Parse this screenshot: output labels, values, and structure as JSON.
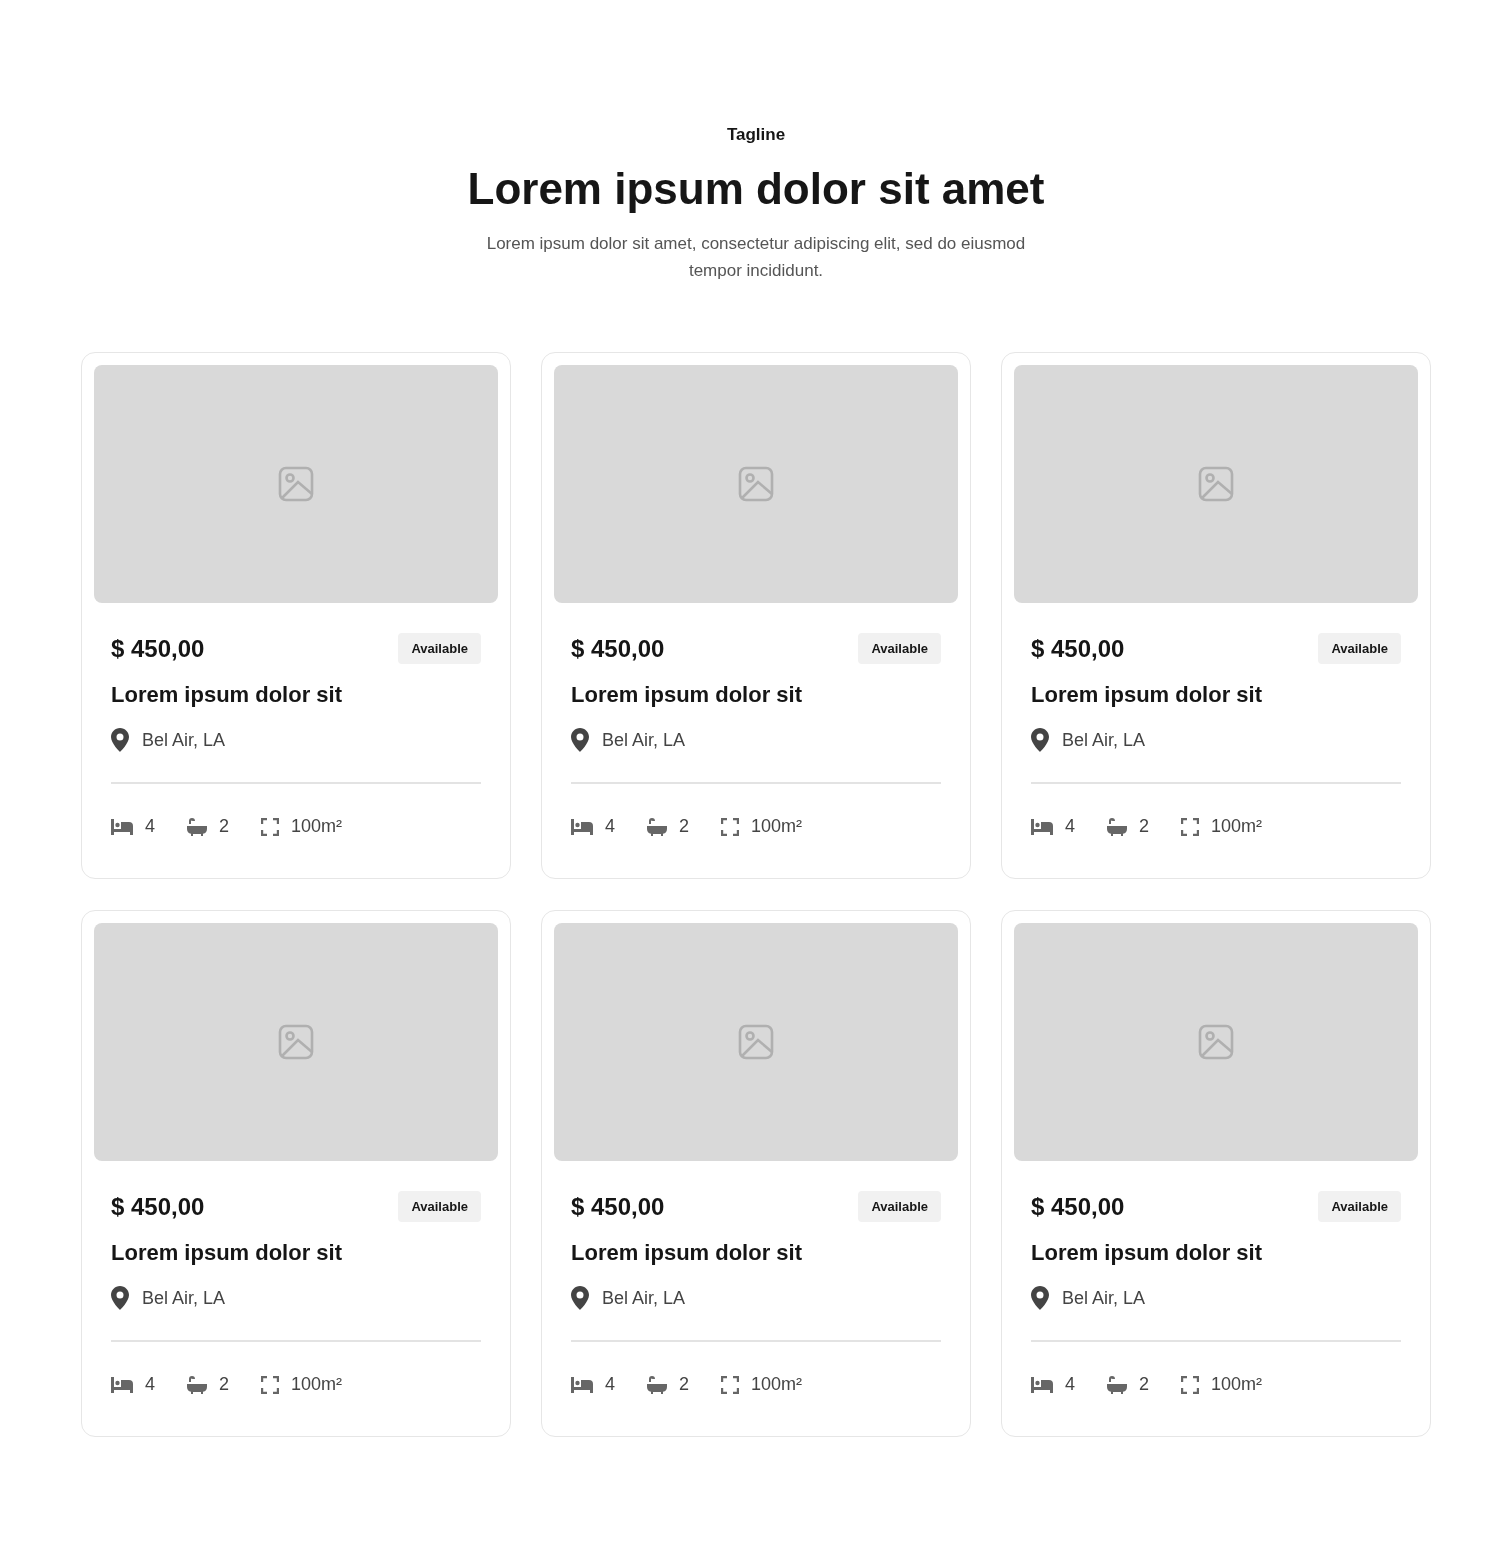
{
  "header": {
    "tagline": "Tagline",
    "title": "Lorem ipsum dolor sit amet",
    "description": "Lorem ipsum dolor sit amet, consectetur adipiscing elit, sed do eiusmod tempor incididunt."
  },
  "listings": [
    {
      "price": "$ 450,00",
      "status": "Available",
      "title": "Lorem ipsum dolor sit",
      "location": "Bel Air, LA",
      "features": [
        {
          "kind": "bed",
          "value": "4"
        },
        {
          "kind": "bath",
          "value": "2"
        },
        {
          "kind": "area",
          "value": "100m²"
        }
      ]
    },
    {
      "price": "$ 450,00",
      "status": "Available",
      "title": "Lorem ipsum dolor sit",
      "location": "Bel Air, LA",
      "features": [
        {
          "kind": "bed",
          "value": "4"
        },
        {
          "kind": "bath",
          "value": "2"
        },
        {
          "kind": "area",
          "value": "100m²"
        }
      ]
    },
    {
      "price": "$ 450,00",
      "status": "Available",
      "title": "Lorem ipsum dolor sit",
      "location": "Bel Air, LA",
      "features": [
        {
          "kind": "bed",
          "value": "4"
        },
        {
          "kind": "bath",
          "value": "2"
        },
        {
          "kind": "area",
          "value": "100m²"
        }
      ]
    },
    {
      "price": "$ 450,00",
      "status": "Available",
      "title": "Lorem ipsum dolor sit",
      "location": "Bel Air, LA",
      "features": [
        {
          "kind": "bed",
          "value": "4"
        },
        {
          "kind": "bath",
          "value": "2"
        },
        {
          "kind": "area",
          "value": "100m²"
        }
      ]
    },
    {
      "price": "$ 450,00",
      "status": "Available",
      "title": "Lorem ipsum dolor sit",
      "location": "Bel Air, LA",
      "features": [
        {
          "kind": "bed",
          "value": "4"
        },
        {
          "kind": "bath",
          "value": "2"
        },
        {
          "kind": "area",
          "value": "100m²"
        }
      ]
    },
    {
      "price": "$ 450,00",
      "status": "Available",
      "title": "Lorem ipsum dolor sit",
      "location": "Bel Air, LA",
      "features": [
        {
          "kind": "bed",
          "value": "4"
        },
        {
          "kind": "bath",
          "value": "2"
        },
        {
          "kind": "area",
          "value": "100m²"
        }
      ]
    }
  ]
}
